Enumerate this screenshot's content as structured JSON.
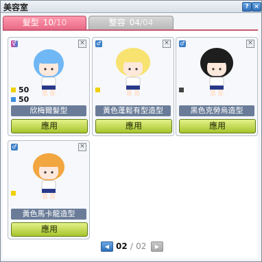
{
  "window": {
    "title": "美容室",
    "help_icon": "?",
    "close_icon": "×"
  },
  "tabs": [
    {
      "label": "髮型",
      "current": "10",
      "max": "/10",
      "active": true
    },
    {
      "label": "整容",
      "current": "04",
      "max": "/04",
      "active": false
    }
  ],
  "cards": [
    {
      "name": "欣梅爾髮型",
      "button": "應用",
      "gender": "unisex",
      "hair_color": "#6fb7f5",
      "swatches": [
        {
          "color": "#f0d000",
          "value": "50"
        },
        {
          "color": "#3c8fe0",
          "value": "50"
        }
      ]
    },
    {
      "name": "黃色蓬鬆有型造型",
      "button": "應用",
      "gender": "male",
      "hair_color": "#f8e270",
      "swatches": [
        {
          "color": "#f0d000",
          "value": ""
        }
      ]
    },
    {
      "name": "黑色克勞烏造型",
      "button": "應用",
      "gender": "male",
      "hair_color": "#1e1e1e",
      "swatches": [
        {
          "color": "#444444",
          "value": ""
        }
      ]
    },
    {
      "name": "黃色馬卡龍造型",
      "button": "應用",
      "gender": "male",
      "hair_color": "#f2a640",
      "swatches": [
        {
          "color": "#f0d000",
          "value": ""
        }
      ]
    }
  ],
  "pagination": {
    "current": "02",
    "separator": "/",
    "total": "02"
  }
}
